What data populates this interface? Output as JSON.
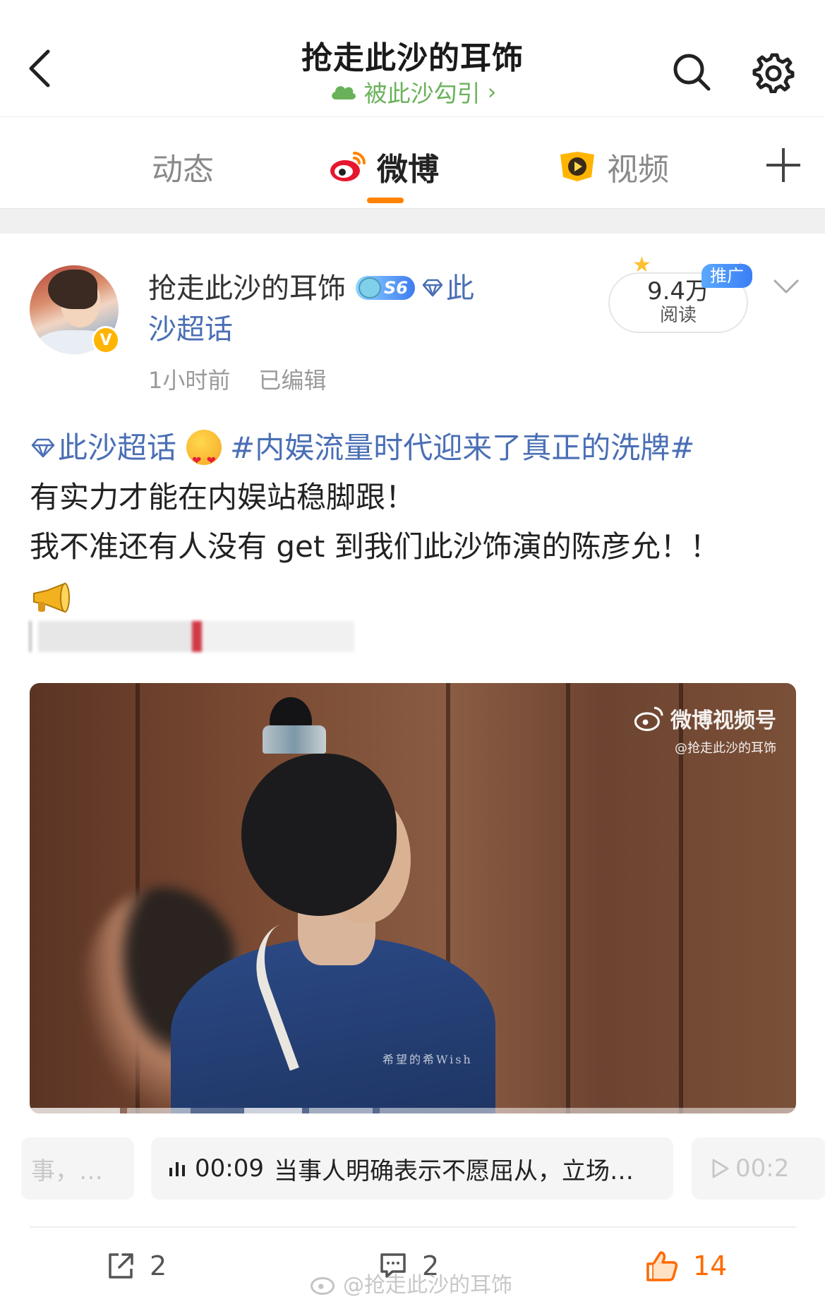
{
  "header": {
    "title": "抢走此沙的耳饰",
    "subtitle": "被此沙勾引",
    "icons": {
      "back": "back-chevron-icon",
      "search": "search-icon",
      "settings": "gear-icon"
    }
  },
  "tabs": [
    {
      "label": "动态",
      "active": false
    },
    {
      "label": "微博",
      "active": true,
      "icon": "weibo-logo-icon"
    },
    {
      "label": "视频",
      "active": false,
      "icon": "video-play-icon"
    }
  ],
  "post": {
    "user": {
      "name": "抢走此沙的耳饰",
      "level": "S6",
      "topic_prefix": "此",
      "topic_rest": "沙超话",
      "verified": true
    },
    "time": "1小时前",
    "edited": "已编辑",
    "reads": {
      "value": "9.4万",
      "label": "阅读"
    },
    "promo_tag": "推广",
    "text": {
      "topic": "此沙超话",
      "hashtag": "#内娱流量时代迎来了真正的洗牌#",
      "line2": "有实力才能在内娱站稳脚跟！",
      "line3": "我不准还有人没有 get 到我们此沙饰演的陈彦允！！"
    },
    "video": {
      "watermark_title": "微博视频号",
      "watermark_sub": "@抢走此沙的耳饰",
      "subtitle": "希望的希Wish"
    },
    "chapters": {
      "left": "事，…",
      "center_time": "00:09",
      "center_text": "当事人明确表示不愿屈从，立场…",
      "right_time": "00:2"
    },
    "actions": {
      "shares": "2",
      "comments": "2",
      "likes": "14"
    },
    "page_watermark": "@抢走此沙的耳饰",
    "colors": {
      "accent": "#ff8200",
      "link": "#4a6fb5",
      "like": "#ff6a00",
      "subtitle_green": "#6ab25a"
    }
  }
}
